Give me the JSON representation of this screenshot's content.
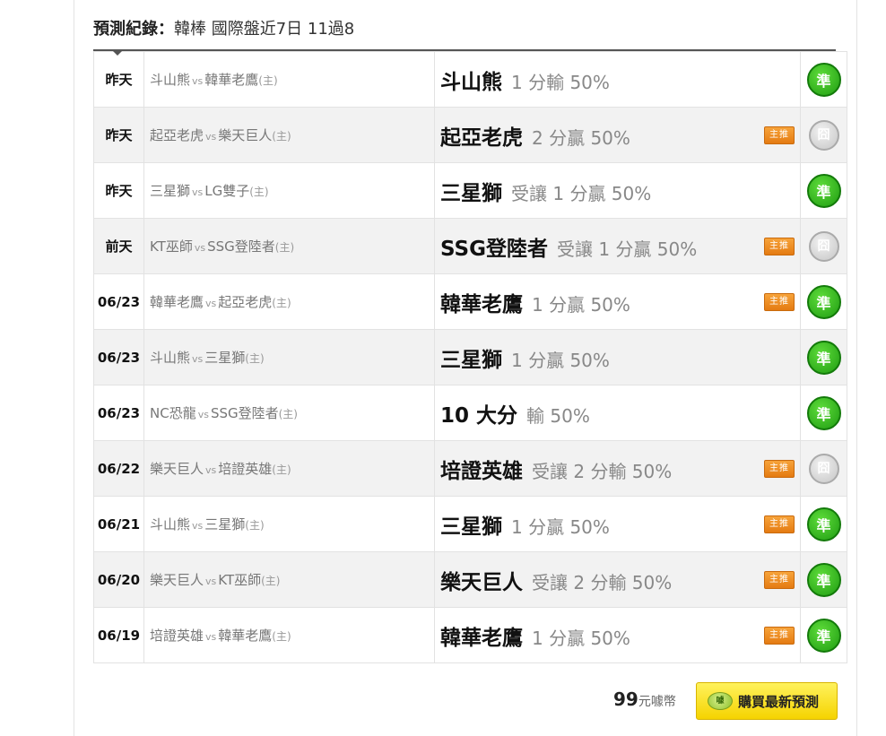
{
  "header": {
    "title": "預測紀錄",
    "colon": "：",
    "subtitle": "韓棒 國際盤近7日 11過8"
  },
  "rows": [
    {
      "date": "昨天",
      "away": "斗山熊",
      "home": "韓華老鷹",
      "pick_team": "斗山熊",
      "pick_detail": "1 分輸 50%",
      "badge": "",
      "result": "準",
      "result_type": "ok"
    },
    {
      "date": "昨天",
      "away": "起亞老虎",
      "home": "樂天巨人",
      "pick_team": "起亞老虎",
      "pick_detail": "2 分贏 50%",
      "badge": "主推",
      "result": "囧",
      "result_type": "miss"
    },
    {
      "date": "昨天",
      "away": "三星獅",
      "home": "LG雙子",
      "pick_team": "三星獅",
      "pick_detail": "受讓 1 分贏 50%",
      "badge": "",
      "result": "準",
      "result_type": "ok"
    },
    {
      "date": "前天",
      "away": "KT巫師",
      "home": "SSG登陸者",
      "pick_team": "SSG登陸者",
      "pick_detail": "受讓 1 分贏 50%",
      "badge": "主推",
      "result": "囧",
      "result_type": "miss"
    },
    {
      "date": "06/23",
      "away": "韓華老鷹",
      "home": "起亞老虎",
      "pick_team": "韓華老鷹",
      "pick_detail": "1 分贏 50%",
      "badge": "主推",
      "result": "準",
      "result_type": "ok"
    },
    {
      "date": "06/23",
      "away": "斗山熊",
      "home": "三星獅",
      "pick_team": "三星獅",
      "pick_detail": "1 分贏 50%",
      "badge": "",
      "result": "準",
      "result_type": "ok"
    },
    {
      "date": "06/23",
      "away": "NC恐龍",
      "home": "SSG登陸者",
      "pick_team": "10 大分",
      "pick_detail": "輸 50%",
      "badge": "",
      "result": "準",
      "result_type": "ok"
    },
    {
      "date": "06/22",
      "away": "樂天巨人",
      "home": "培證英雄",
      "pick_team": "培證英雄",
      "pick_detail": "受讓 2 分輸 50%",
      "badge": "主推",
      "result": "囧",
      "result_type": "miss"
    },
    {
      "date": "06/21",
      "away": "斗山熊",
      "home": "三星獅",
      "pick_team": "三星獅",
      "pick_detail": "1 分贏 50%",
      "badge": "主推",
      "result": "準",
      "result_type": "ok"
    },
    {
      "date": "06/20",
      "away": "樂天巨人",
      "home": "KT巫師",
      "pick_team": "樂天巨人",
      "pick_detail": "受讓 2 分輸 50%",
      "badge": "主推",
      "result": "準",
      "result_type": "ok"
    },
    {
      "date": "06/19",
      "away": "培證英雄",
      "home": "韓華老鷹",
      "pick_team": "韓華老鷹",
      "pick_detail": "1 分贏 50%",
      "badge": "主推",
      "result": "準",
      "result_type": "ok"
    }
  ],
  "labels": {
    "vs": "vs",
    "home_marker": "(主)"
  },
  "footer": {
    "price_value": "99",
    "price_unit": "元噱幣",
    "buy_label": "購買最新預測",
    "coin_icon_text": "噱"
  },
  "colors": {
    "ok_green": "#1f9c12",
    "miss_gray": "#c6c6c6",
    "badge_orange": "#e47b12",
    "button_yellow": "#f5d300"
  }
}
